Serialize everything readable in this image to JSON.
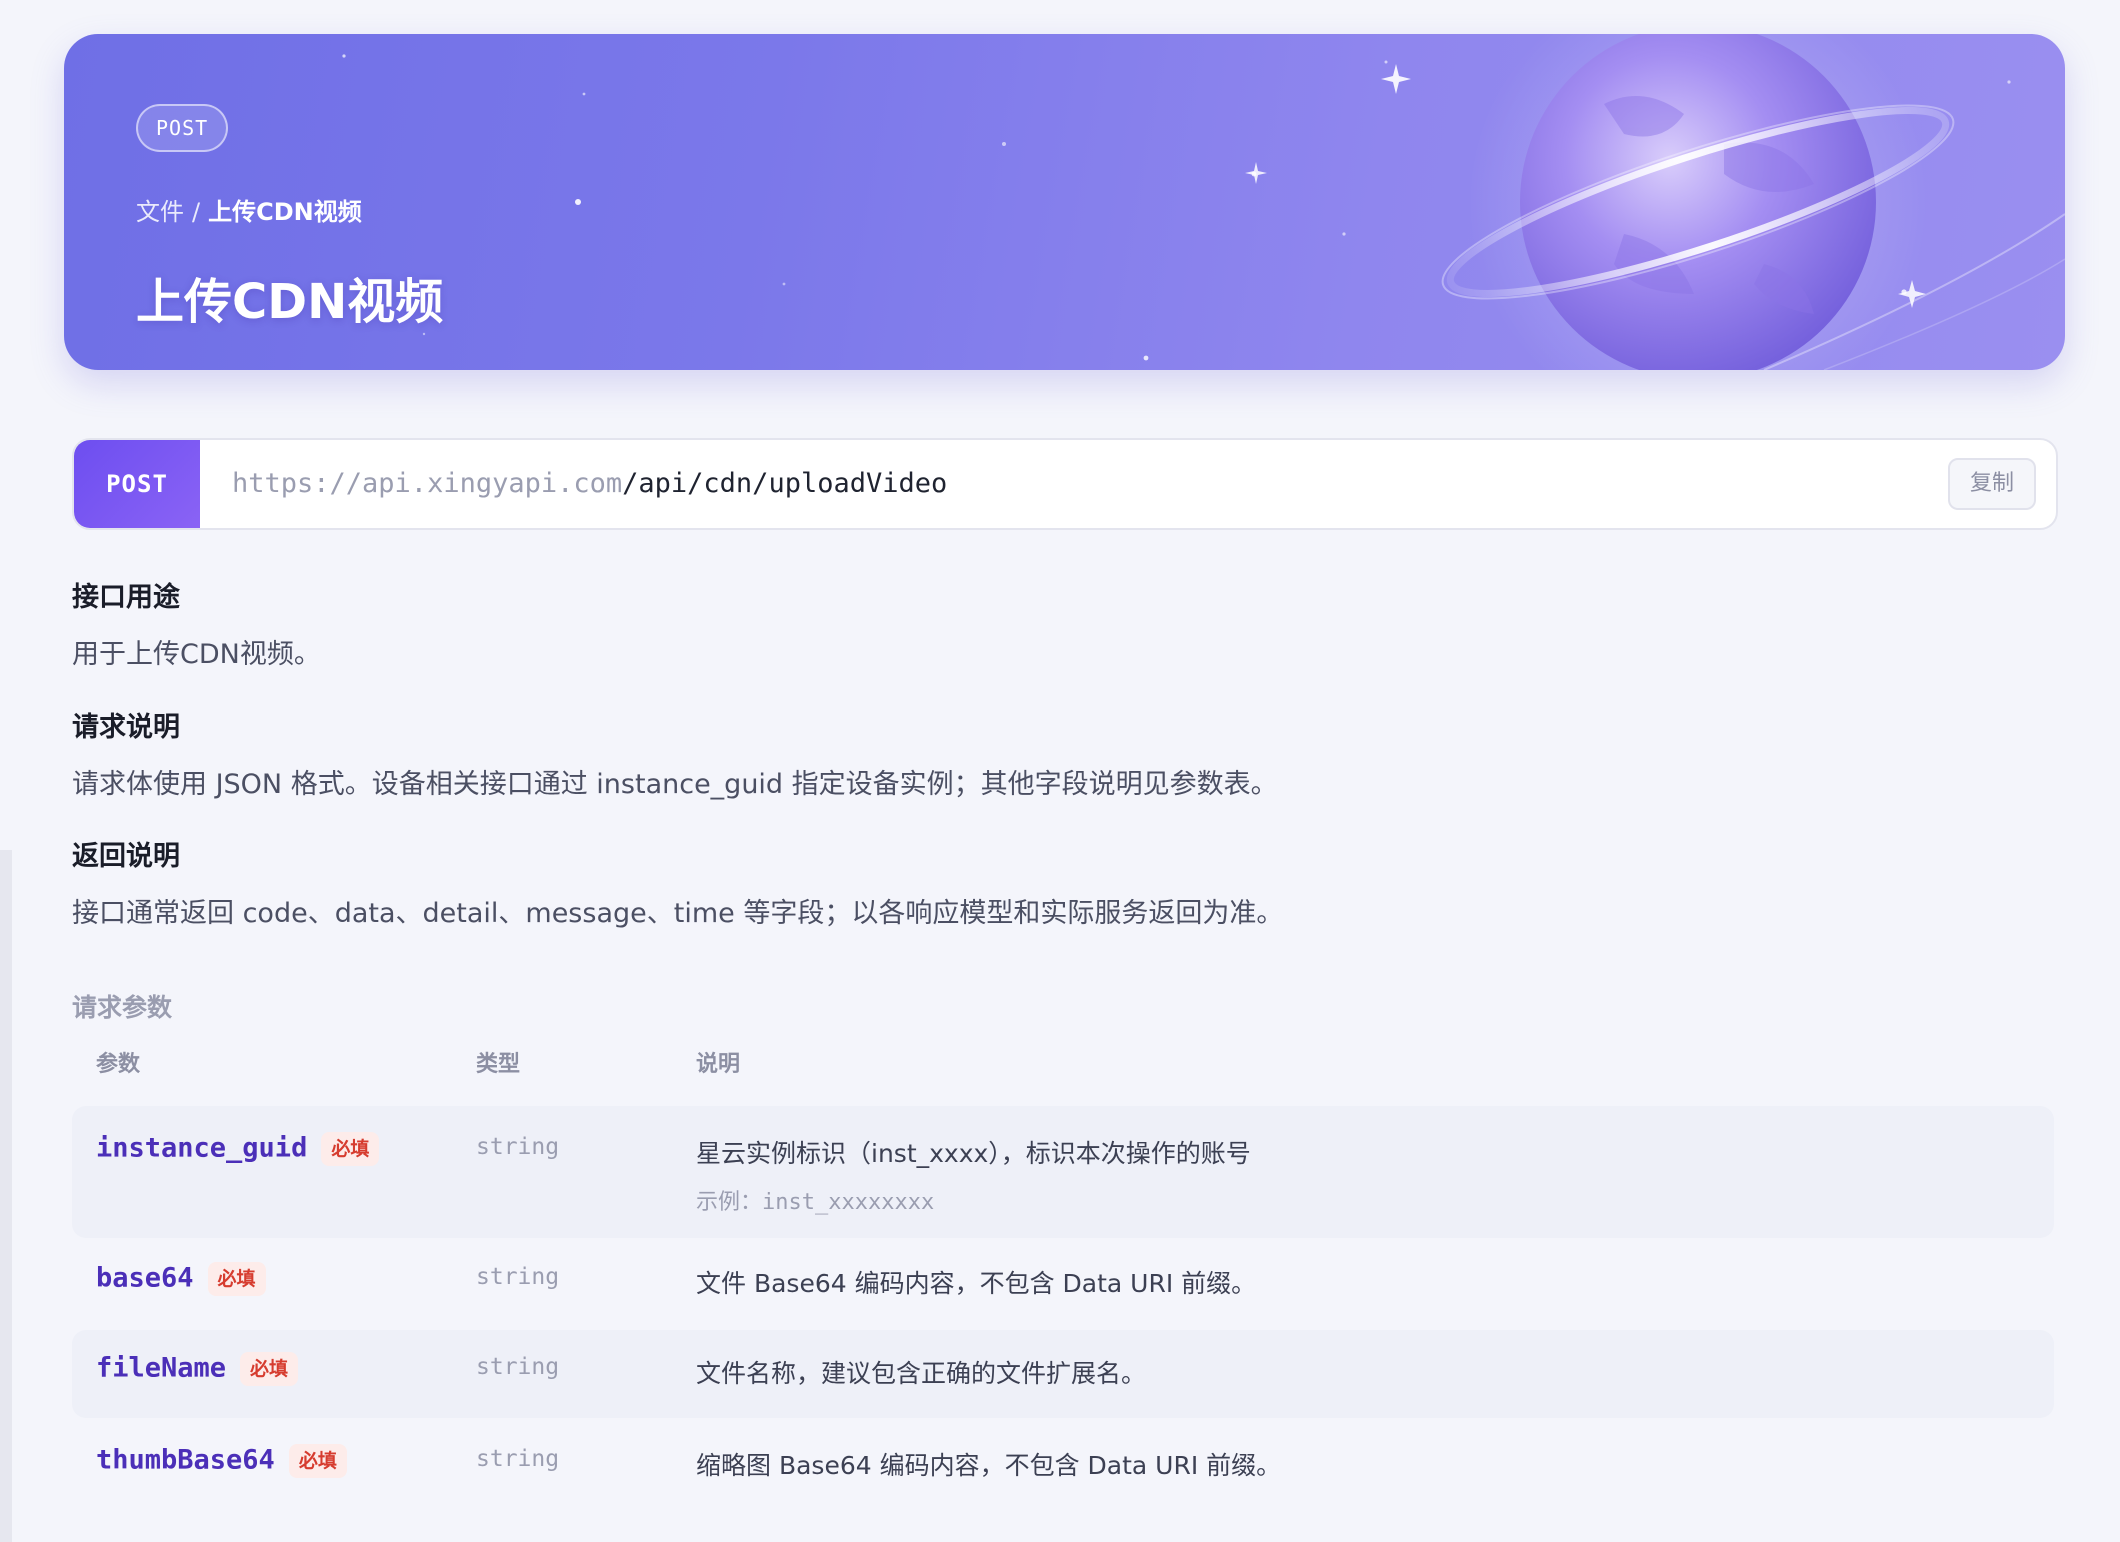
{
  "hero": {
    "method": "POST",
    "breadcrumb_parent": "文件",
    "breadcrumb_sep": "/",
    "breadcrumb_current": "上传CDN视频",
    "title": "上传CDN视频"
  },
  "endpoint": {
    "method": "POST",
    "host": "https://api.xingyapi.com",
    "path": "/api/cdn/uploadVideo",
    "copy_label": "复制"
  },
  "sections": {
    "purpose_title": "接口用途",
    "purpose_text": "用于上传CDN视频。",
    "request_title": "请求说明",
    "request_text": "请求体使用 JSON 格式。设备相关接口通过 instance_guid 指定设备实例；其他字段说明见参数表。",
    "response_title": "返回说明",
    "response_text": "接口通常返回 code、data、detail、message、time 等字段；以各响应模型和实际服务返回为准。"
  },
  "params": {
    "heading": "请求参数",
    "columns": {
      "name": "参数",
      "type": "类型",
      "desc": "说明"
    },
    "rows": [
      {
        "name": "instance_guid",
        "required_label": "必填",
        "type": "string",
        "desc": "星云实例标识（inst_xxxx），标识本次操作的账号",
        "example_label": "示例：",
        "example_value": "inst_xxxxxxxx"
      },
      {
        "name": "base64",
        "required_label": "必填",
        "type": "string",
        "desc": "文件 Base64 编码内容，不包含 Data URI 前缀。"
      },
      {
        "name": "fileName",
        "required_label": "必填",
        "type": "string",
        "desc": "文件名称，建议包含正确的文件扩展名。"
      },
      {
        "name": "thumbBase64",
        "required_label": "必填",
        "type": "string",
        "desc": "缩略图 Base64 编码内容，不包含 Data URI 前缀。"
      }
    ]
  },
  "colors": {
    "accent": "#6d4ef0",
    "param_name": "#4b2fb8",
    "required_bg": "#fdecea",
    "required_text": "#d63c2f",
    "page_bg": "#f4f5fb"
  },
  "icons": [
    "planet-illustration",
    "star-sparkle-icon"
  ]
}
